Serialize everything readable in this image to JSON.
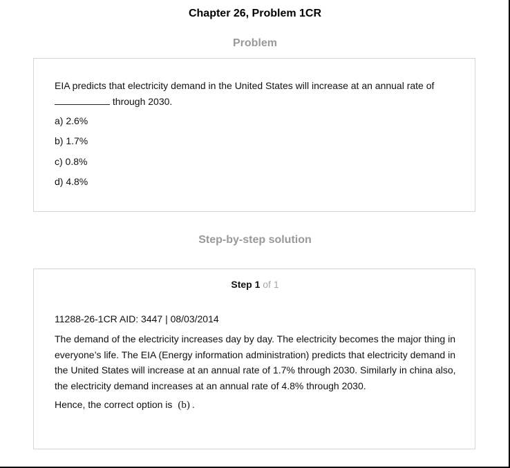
{
  "header": {
    "chapter_title": "Chapter 26, Problem 1CR"
  },
  "problem": {
    "heading": "Problem",
    "text_before_blank": "EIA predicts that electricity demand in the United States will increase at an annual rate of",
    "text_after_blank": " through 2030.",
    "options": [
      "a) 2.6%",
      "b) 1.7%",
      "c) 0.8%",
      "d) 4.8%"
    ]
  },
  "solution": {
    "heading": "Step-by-step solution",
    "step_word": "Step 1",
    "step_of": " of 1",
    "aid_line": "11288-26-1CR AID: 3447 | 08/03/2014",
    "body": "The demand of the electricity increases day by day. The electricity becomes the major thing in everyone’s life. The EIA (Energy information administration) predicts that electricity demand in the United States will increase at an annual rate of 1.7% through 2030. Similarly in china also, the electricity demand increases at an annual rate of 4.8% through 2030.",
    "conclusion_prefix": "Hence, the correct option is",
    "answer": "(b)",
    "conclusion_suffix": "."
  }
}
